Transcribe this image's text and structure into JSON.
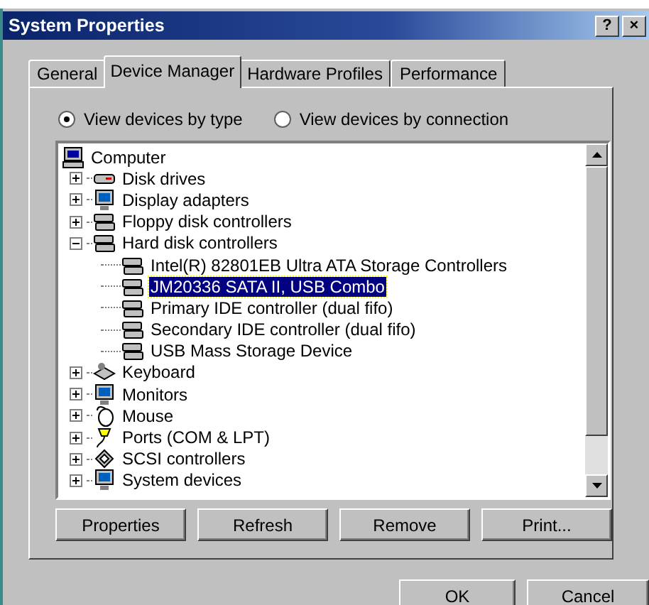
{
  "window": {
    "title": "System Properties",
    "controls": [
      "?",
      "×"
    ]
  },
  "tabs": [
    {
      "label": "General",
      "selected": false
    },
    {
      "label": "Device Manager",
      "selected": true
    },
    {
      "label": "Hardware Profiles",
      "selected": false
    },
    {
      "label": "Performance",
      "selected": false
    }
  ],
  "view_options": [
    {
      "label": "View devices by type",
      "selected": true
    },
    {
      "label": "View devices by connection",
      "selected": false
    }
  ],
  "tree": [
    {
      "label": "Computer",
      "kind": "computer",
      "selected": false,
      "children": [
        {
          "label": "Disk drives",
          "kind": "disk",
          "selected": false,
          "expanded": false
        },
        {
          "label": "Display adapters",
          "kind": "display",
          "selected": false,
          "expanded": false
        },
        {
          "label": "Floppy disk controllers",
          "kind": "controller",
          "selected": false,
          "expanded": false
        },
        {
          "label": "Hard disk controllers",
          "kind": "controller",
          "selected": false,
          "expanded": true,
          "children": [
            {
              "label": "Intel(R) 82801EB Ultra ATA Storage Controllers",
              "kind": "controller",
              "selected": false
            },
            {
              "label": "JM20336 SATA II, USB Combo",
              "kind": "controller",
              "selected": true
            },
            {
              "label": "Primary IDE controller (dual fifo)",
              "kind": "controller",
              "selected": false
            },
            {
              "label": "Secondary IDE controller (dual fifo)",
              "kind": "controller",
              "selected": false
            },
            {
              "label": "USB Mass Storage Device",
              "kind": "controller",
              "selected": false
            }
          ]
        },
        {
          "label": "Keyboard",
          "kind": "keyboard",
          "selected": false,
          "expanded": false
        },
        {
          "label": "Monitors",
          "kind": "display",
          "selected": false,
          "expanded": false
        },
        {
          "label": "Mouse",
          "kind": "mouse",
          "selected": false,
          "expanded": false
        },
        {
          "label": "Ports (COM & LPT)",
          "kind": "port",
          "selected": false,
          "expanded": false
        },
        {
          "label": "SCSI controllers",
          "kind": "scsi",
          "selected": false,
          "expanded": false
        },
        {
          "label": "System devices",
          "kind": "display",
          "selected": false,
          "expanded": false
        }
      ]
    }
  ],
  "action_buttons": [
    "Properties",
    "Refresh",
    "Remove",
    "Print..."
  ],
  "dialog_buttons": [
    "OK",
    "Cancel"
  ]
}
